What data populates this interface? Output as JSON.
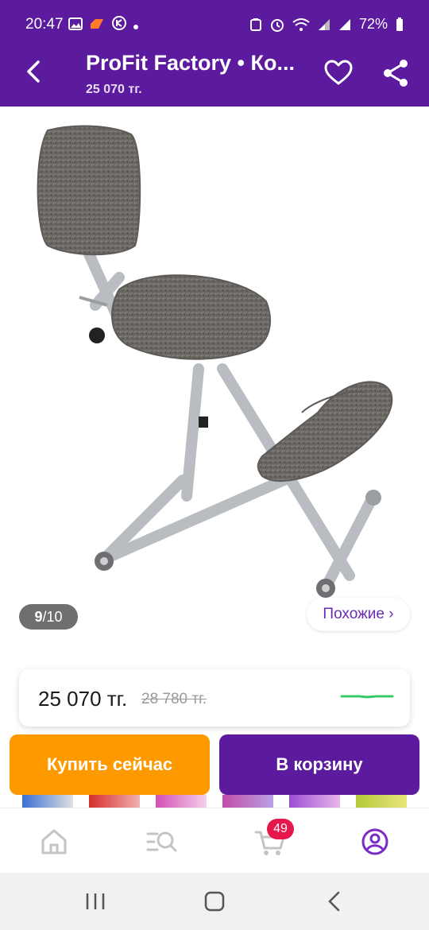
{
  "status_bar": {
    "time": "20:47",
    "battery": "72%",
    "notification_icons": [
      "image-icon",
      "brand-icon",
      "app-icon",
      "dot-icon"
    ],
    "system_icons": [
      "recycle-icon",
      "alarm-icon",
      "wifi-icon",
      "signal-icon",
      "signal-icon",
      "battery-icon"
    ]
  },
  "header": {
    "title": "ProFit Factory • Ко...",
    "subtitle": "25 070 тг."
  },
  "gallery": {
    "counter_current": "9",
    "counter_sep": " / ",
    "counter_total": "10",
    "similar_label": "Похожие ›"
  },
  "price": {
    "current": "25 070 тг.",
    "old": "28 780 тг."
  },
  "actions": {
    "buy_now": "Купить сейчас",
    "add_to_cart": "В корзину"
  },
  "bottom_nav": {
    "cart_badge": "49",
    "items": [
      "home-icon",
      "catalog-search-icon",
      "cart-icon",
      "profile-icon"
    ]
  },
  "colors": {
    "brand": "#5c1a9e",
    "accent": "#ff9900",
    "badge": "#e8174b",
    "link": "#6a2bb2"
  }
}
